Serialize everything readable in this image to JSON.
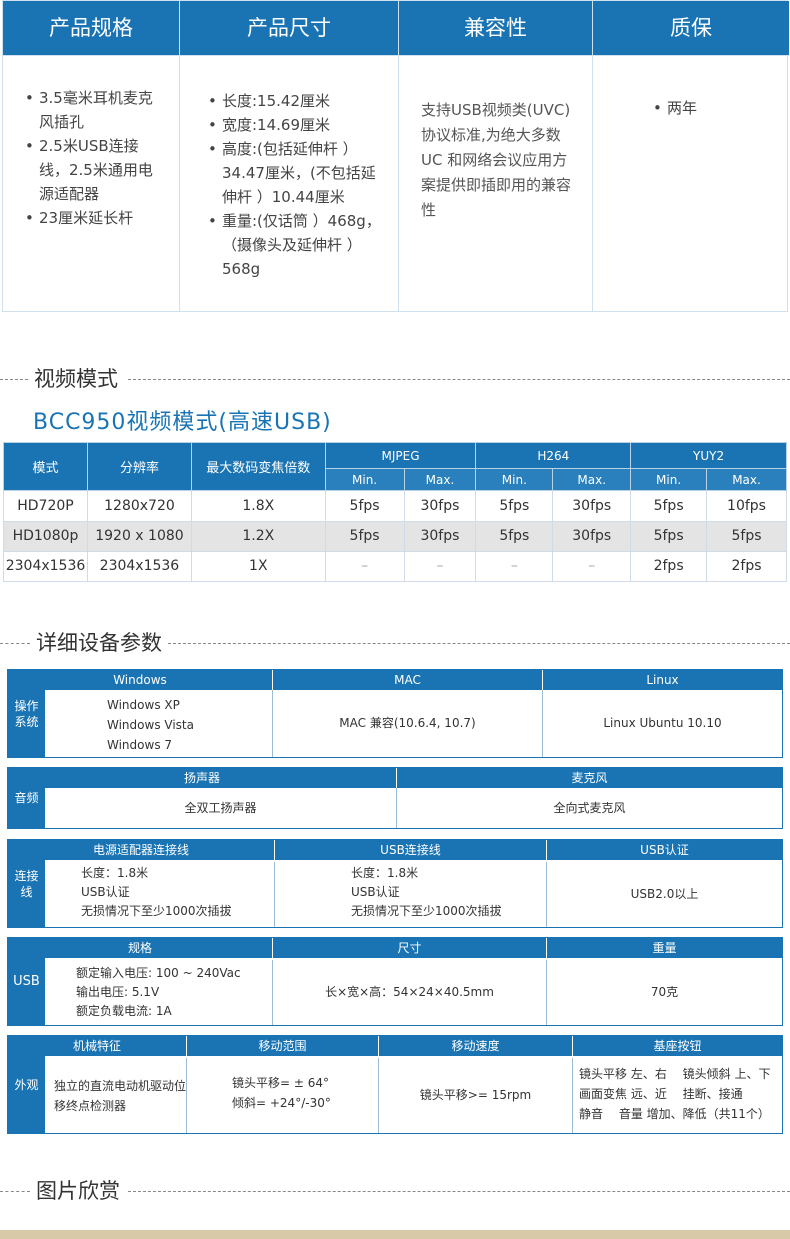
{
  "spec_table": {
    "headers": [
      "产品规格",
      "产品尺寸",
      "兼容性",
      "质保"
    ],
    "spec_items": [
      "3.5毫米耳机麦克风插孔",
      "2.5米USB连接线，2.5米通用电源适配器",
      "23厘米延长杆"
    ],
    "size_items": [
      "长度:15.42厘米",
      "宽度:14.69厘米",
      "高度:(包括延伸杆 ）34.47厘米，(不包括延伸杆 ）10.44厘米",
      "重量:(仅话筒 ）468g，（摄像头及延伸杆 ）568g"
    ],
    "compat_text": "支持USB视频类(UVC) 协议标准,为绝大多数 UC 和网络会议应用方案提供即插即用的兼容性",
    "warranty_items": [
      "两年"
    ]
  },
  "section_video": "视频模式",
  "bcc_title": "BCC950视频模式(高速USB)",
  "video_table": {
    "headers": {
      "mode": "模式",
      "resolution": "分辨率",
      "zoom": "最大数码变焦倍数"
    },
    "groups": [
      "MJPEG",
      "H264",
      "YUY2"
    ],
    "sub": {
      "min": "Min.",
      "max": "Max."
    },
    "rows": [
      [
        "HD720P",
        "1280x720",
        "1.8X",
        "5fps",
        "30fps",
        "5fps",
        "30fps",
        "5fps",
        "10fps"
      ],
      [
        "HD1080p",
        "1920 x 1080",
        "1.2X",
        "5fps",
        "30fps",
        "5fps",
        "30fps",
        "5fps",
        "5fps"
      ],
      [
        "2304x1536",
        "2304x1536",
        "1X",
        "–",
        "–",
        "–",
        "–",
        "2fps",
        "2fps"
      ]
    ]
  },
  "section_detail": "详细设备参数",
  "os_block": {
    "side": "操作系统",
    "headers": [
      "Windows",
      "MAC",
      "Linux"
    ],
    "windows": [
      "Windows XP",
      "Windows Vista",
      "Windows 7"
    ],
    "mac": "MAC 兼容(10.6.4, 10.7)",
    "linux": "Linux Ubuntu 10.10"
  },
  "audio_block": {
    "side": "音频",
    "headers": [
      "扬声器",
      "麦克风"
    ],
    "speaker": "全双工扬声器",
    "mic": "全向式麦克风"
  },
  "cable_block": {
    "side": "连接线",
    "headers": [
      "电源适配器连接线",
      "USB连接线",
      "USB认证"
    ],
    "power": [
      "长度：1.8米",
      "USB认证",
      "无损情况下至少1000次插拔"
    ],
    "usb": [
      "长度：1.8米",
      "USB认证",
      "无损情况下至少1000次插拔"
    ],
    "cert": "USB2.0以上"
  },
  "usb_block": {
    "side": "USB",
    "headers": [
      "规格",
      "尺寸",
      "重量"
    ],
    "spec": [
      "额定输入电压: 100 ~ 240Vac",
      "输出电压: 5.1V",
      "额定负载电流: 1A"
    ],
    "size": "长×宽×高：54×24×40.5mm",
    "weight": "70克"
  },
  "look_block": {
    "side": "外观",
    "headers": [
      "机械特征",
      "移动范围",
      "移动速度",
      "基座按钮"
    ],
    "mech": "独立的直流电动机驱动位移终点检测器",
    "range": [
      "镜头平移= ± 64°",
      "倾斜= +24°/-30°"
    ],
    "speed": "镜头平移>= 15rpm",
    "buttons": [
      "镜头平移 左、右　 镜头倾斜 上、下",
      "画面变焦 远、近　 挂断、接通",
      "静音　 音量 增加、降低（共11个）"
    ]
  },
  "section_gallery": "图片欣赏"
}
